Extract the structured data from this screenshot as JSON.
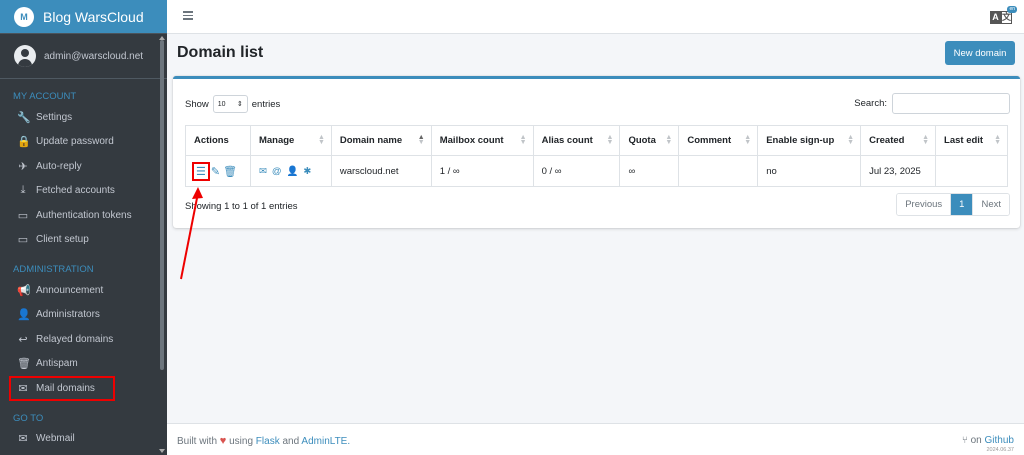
{
  "brand": {
    "name": "Blog WarsCloud",
    "logo_text": "M"
  },
  "user": {
    "email": "admin@warscloud.net"
  },
  "sidebar": {
    "sections": [
      {
        "header": "MY ACCOUNT",
        "items": [
          {
            "label": "Settings",
            "icon": "wrench-icon"
          },
          {
            "label": "Update password",
            "icon": "lock-icon"
          },
          {
            "label": "Auto-reply",
            "icon": "plane-icon"
          },
          {
            "label": "Fetched accounts",
            "icon": "download-icon"
          },
          {
            "label": "Authentication tokens",
            "icon": "ticket-icon"
          },
          {
            "label": "Client setup",
            "icon": "laptop-icon"
          }
        ]
      },
      {
        "header": "ADMINISTRATION",
        "items": [
          {
            "label": "Announcement",
            "icon": "bullhorn-icon"
          },
          {
            "label": "Administrators",
            "icon": "user-icon"
          },
          {
            "label": "Relayed domains",
            "icon": "reply-all-icon"
          },
          {
            "label": "Antispam",
            "icon": "trash-icon"
          },
          {
            "label": "Mail domains",
            "icon": "envelope-icon"
          }
        ]
      },
      {
        "header": "GO TO",
        "items": [
          {
            "label": "Webmail",
            "icon": "envelope-icon"
          }
        ]
      }
    ]
  },
  "topbar": {
    "lang_a": "A",
    "lang_b": "文",
    "lang_badge": "en"
  },
  "page": {
    "title": "Domain list",
    "new_button": "New domain"
  },
  "table_controls": {
    "show_label": "Show",
    "entries_value": "10",
    "entries_label": "entries",
    "search_label": "Search:"
  },
  "table": {
    "headers": [
      "Actions",
      "Manage",
      "Domain name",
      "Mailbox count",
      "Alias count",
      "Quota",
      "Comment",
      "Enable sign-up",
      "Created",
      "Last edit"
    ],
    "rows": [
      {
        "domain": "warscloud.net",
        "mailbox_count": "1 / ∞",
        "alias_count": "0 / ∞",
        "quota": "∞",
        "comment": "",
        "enable_signup": "no",
        "created": "Jul 23, 2025",
        "last_edit": ""
      }
    ]
  },
  "info_text": "Showing 1 to 1 of 1 entries",
  "pagination": {
    "previous": "Previous",
    "current": "1",
    "next": "Next"
  },
  "footer": {
    "built_with": "Built with",
    "heart": "♥",
    "using": "using",
    "flask": "Flask",
    "and": "and",
    "adminlte": "AdminLTE.",
    "on": "on",
    "github": "Github",
    "version": "2024.06.37"
  },
  "colors": {
    "primary": "#3c8dbc",
    "sidebar": "#343a40",
    "highlight": "#ee0000"
  }
}
